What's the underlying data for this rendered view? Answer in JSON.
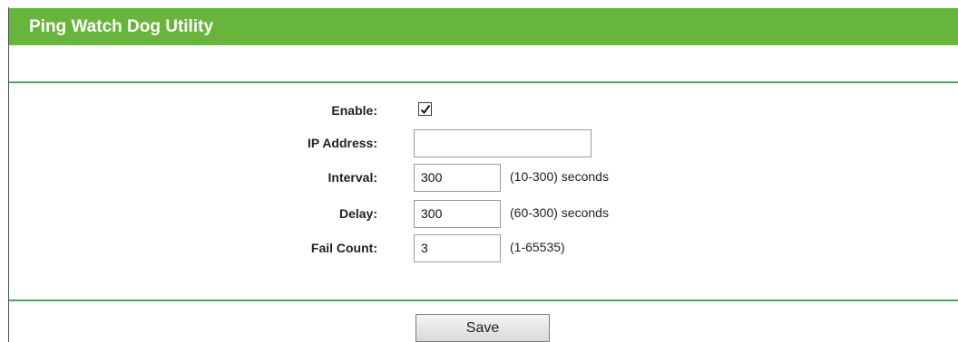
{
  "header": {
    "title": "Ping Watch Dog Utility"
  },
  "form": {
    "enable": {
      "label": "Enable:",
      "checked": true
    },
    "ip_address": {
      "label": "IP Address:",
      "value": ""
    },
    "interval": {
      "label": "Interval:",
      "value": "300",
      "hint": "(10-300) seconds"
    },
    "delay": {
      "label": "Delay:",
      "value": "300",
      "hint": "(60-300) seconds"
    },
    "fail_count": {
      "label": "Fail Count:",
      "value": "3",
      "hint": "(1-65535)"
    }
  },
  "actions": {
    "save_label": "Save"
  },
  "colors": {
    "header_bg": "#68b53b",
    "rule": "#4aa35c"
  }
}
